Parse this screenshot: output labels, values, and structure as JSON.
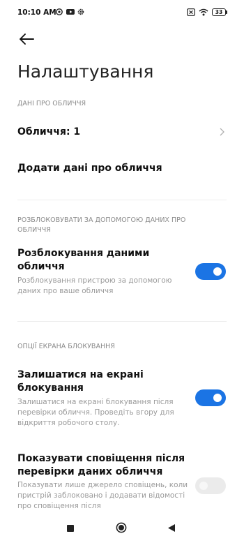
{
  "status_bar": {
    "time": "10:10 AM",
    "left_icons": [
      "whatsapp-icon",
      "youtube-icon",
      "settings-gear-icon"
    ],
    "right_icons": [
      "sim-card-icon",
      "wifi-icon",
      "battery-icon"
    ],
    "battery_level": "33"
  },
  "header": {
    "back_icon": "arrow-left-icon",
    "title": "Налаштування"
  },
  "sections": {
    "face_data": {
      "header": "ДАНІ ПРО ОБЛИЧЧЯ",
      "faces_label": "Обличчя: 1",
      "add_label": "Додати дані про обличчя"
    },
    "unlock": {
      "header": "РОЗБЛОКОВУВАТИ ЗА ДОПОМОГОЮ ДАНИХ ПРО ОБЛИЧЧЯ",
      "title": "Розблокування даними обличчя",
      "subtitle": "Розблокування пристрою за допомогою даних про ваше обличчя",
      "enabled": true
    },
    "lock_screen": {
      "header": "ОПЦІЇ ЕКРАНА БЛОКУВАННЯ",
      "stay_title": "Залишатися на екрані блокування",
      "stay_subtitle": "Залишатися на екрані блокування після перевірки обличчя. Проведіть вгору для відкриття робочого столу.",
      "stay_enabled": true,
      "notif_title": "Показувати сповіщення після перевірки даних обличчя",
      "notif_subtitle": "Показувати лише джерело сповіщень, коли пристрій заблоковано і додавати відомості про сповіщення після",
      "notif_enabled": false
    }
  },
  "nav_bar": {
    "buttons": [
      "recents-square-icon",
      "home-circle-icon",
      "back-triangle-icon"
    ]
  },
  "colors": {
    "accent": "#1b74e4",
    "toggle_off": "#ebebeb",
    "section_header": "#8a8a8a",
    "subtitle": "#9a9a9a"
  }
}
